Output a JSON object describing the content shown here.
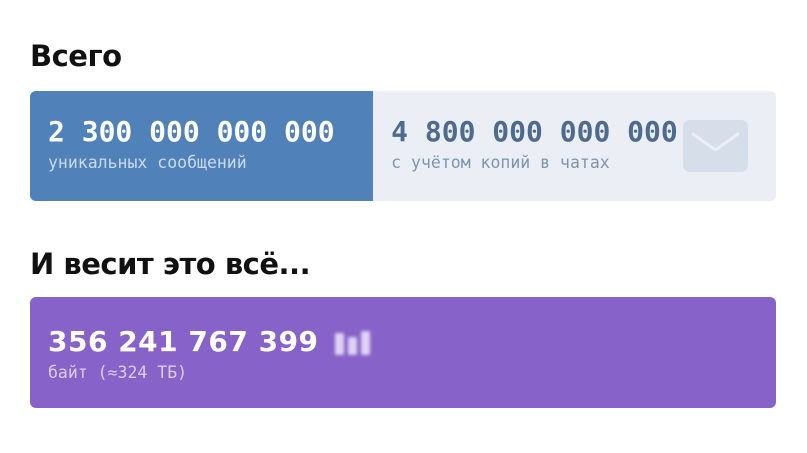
{
  "totals": {
    "title": "Всего",
    "unique": {
      "value": "2 300 000 000 000",
      "label": "уникальных сообщений"
    },
    "with_copies": {
      "value": "4 800 000 000 000",
      "label": "с учётом копий в чатах",
      "icon": "envelope-icon"
    },
    "colors": {
      "unique_bg": "#5081b9",
      "copies_bg": "#ebeff5"
    },
    "unique_share": 0.46
  },
  "weight": {
    "title": "И весит это всё...",
    "value": "356 241 767 399",
    "label": "байт (≈324 ТБ)",
    "colors": {
      "bg": "#8762c9"
    }
  }
}
